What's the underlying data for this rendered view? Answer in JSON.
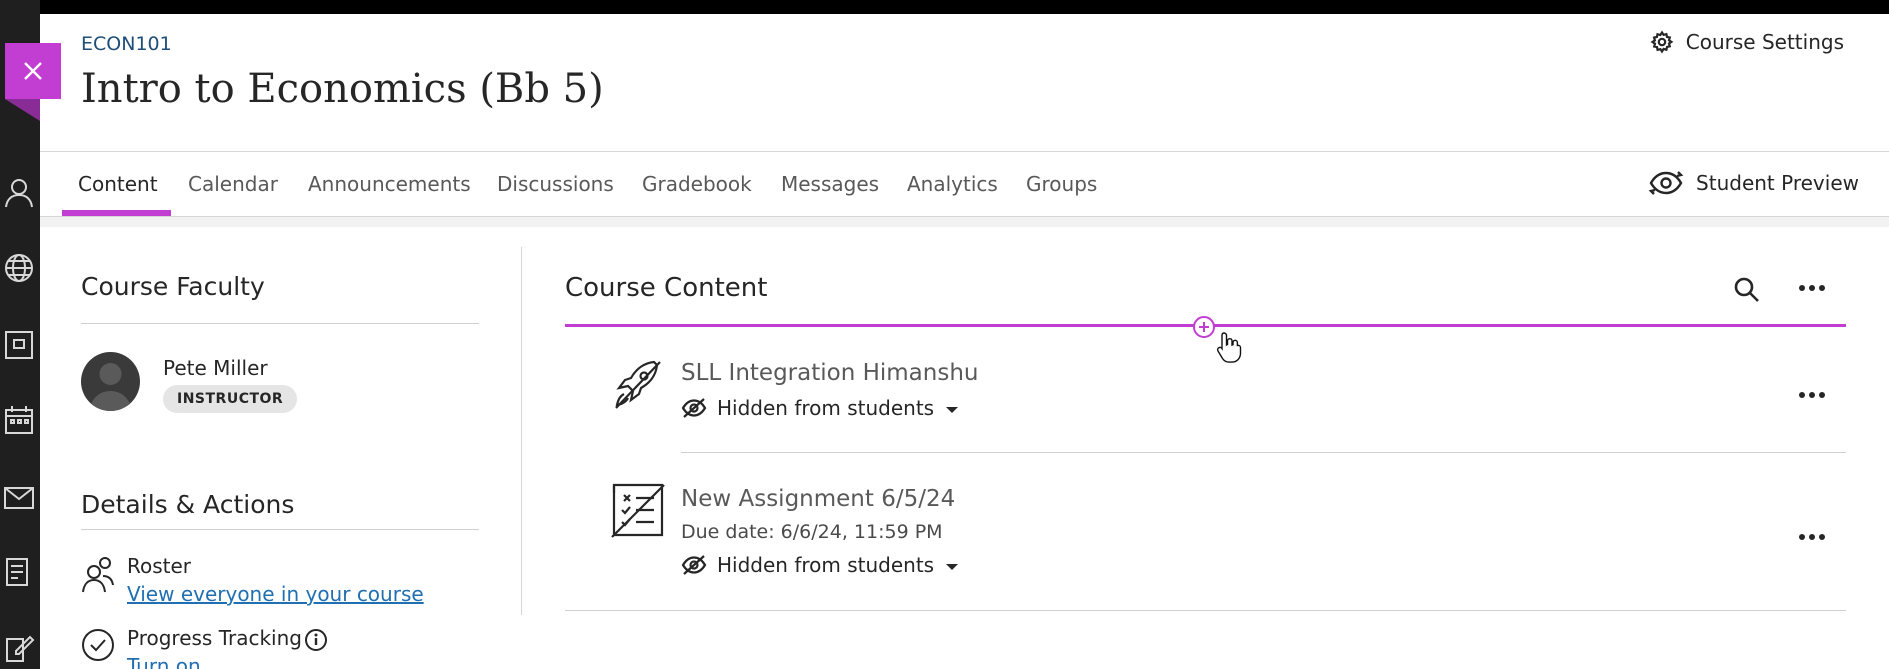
{
  "header": {
    "course_code": "ECON101",
    "course_title": "Intro to Economics (Bb 5)",
    "settings_label": "Course Settings"
  },
  "tabs": [
    {
      "label": "Content",
      "active": true
    },
    {
      "label": "Calendar",
      "active": false
    },
    {
      "label": "Announcements",
      "active": false
    },
    {
      "label": "Discussions",
      "active": false
    },
    {
      "label": "Gradebook",
      "active": false
    },
    {
      "label": "Messages",
      "active": false
    },
    {
      "label": "Analytics",
      "active": false
    },
    {
      "label": "Groups",
      "active": false
    }
  ],
  "student_preview_label": "Student Preview",
  "sidebar": {
    "faculty_title": "Course Faculty",
    "faculty": {
      "name": "Pete Miller",
      "role": "INSTRUCTOR"
    },
    "details_title": "Details & Actions",
    "roster": {
      "label": "Roster",
      "link": "View everyone in your course"
    },
    "progress": {
      "label": "Progress Tracking",
      "link": "Turn on"
    }
  },
  "content": {
    "title": "Course Content",
    "items": [
      {
        "title": "SLL Integration Himanshu",
        "visibility": "Hidden from students",
        "icon": "rocket-icon"
      },
      {
        "title": "New Assignment 6/5/24",
        "due": "Due date: 6/6/24, 11:59 PM",
        "visibility": "Hidden from students",
        "icon": "assignment-icon"
      }
    ]
  },
  "colors": {
    "accent": "#c23dd2",
    "link": "#1f6fb2"
  }
}
